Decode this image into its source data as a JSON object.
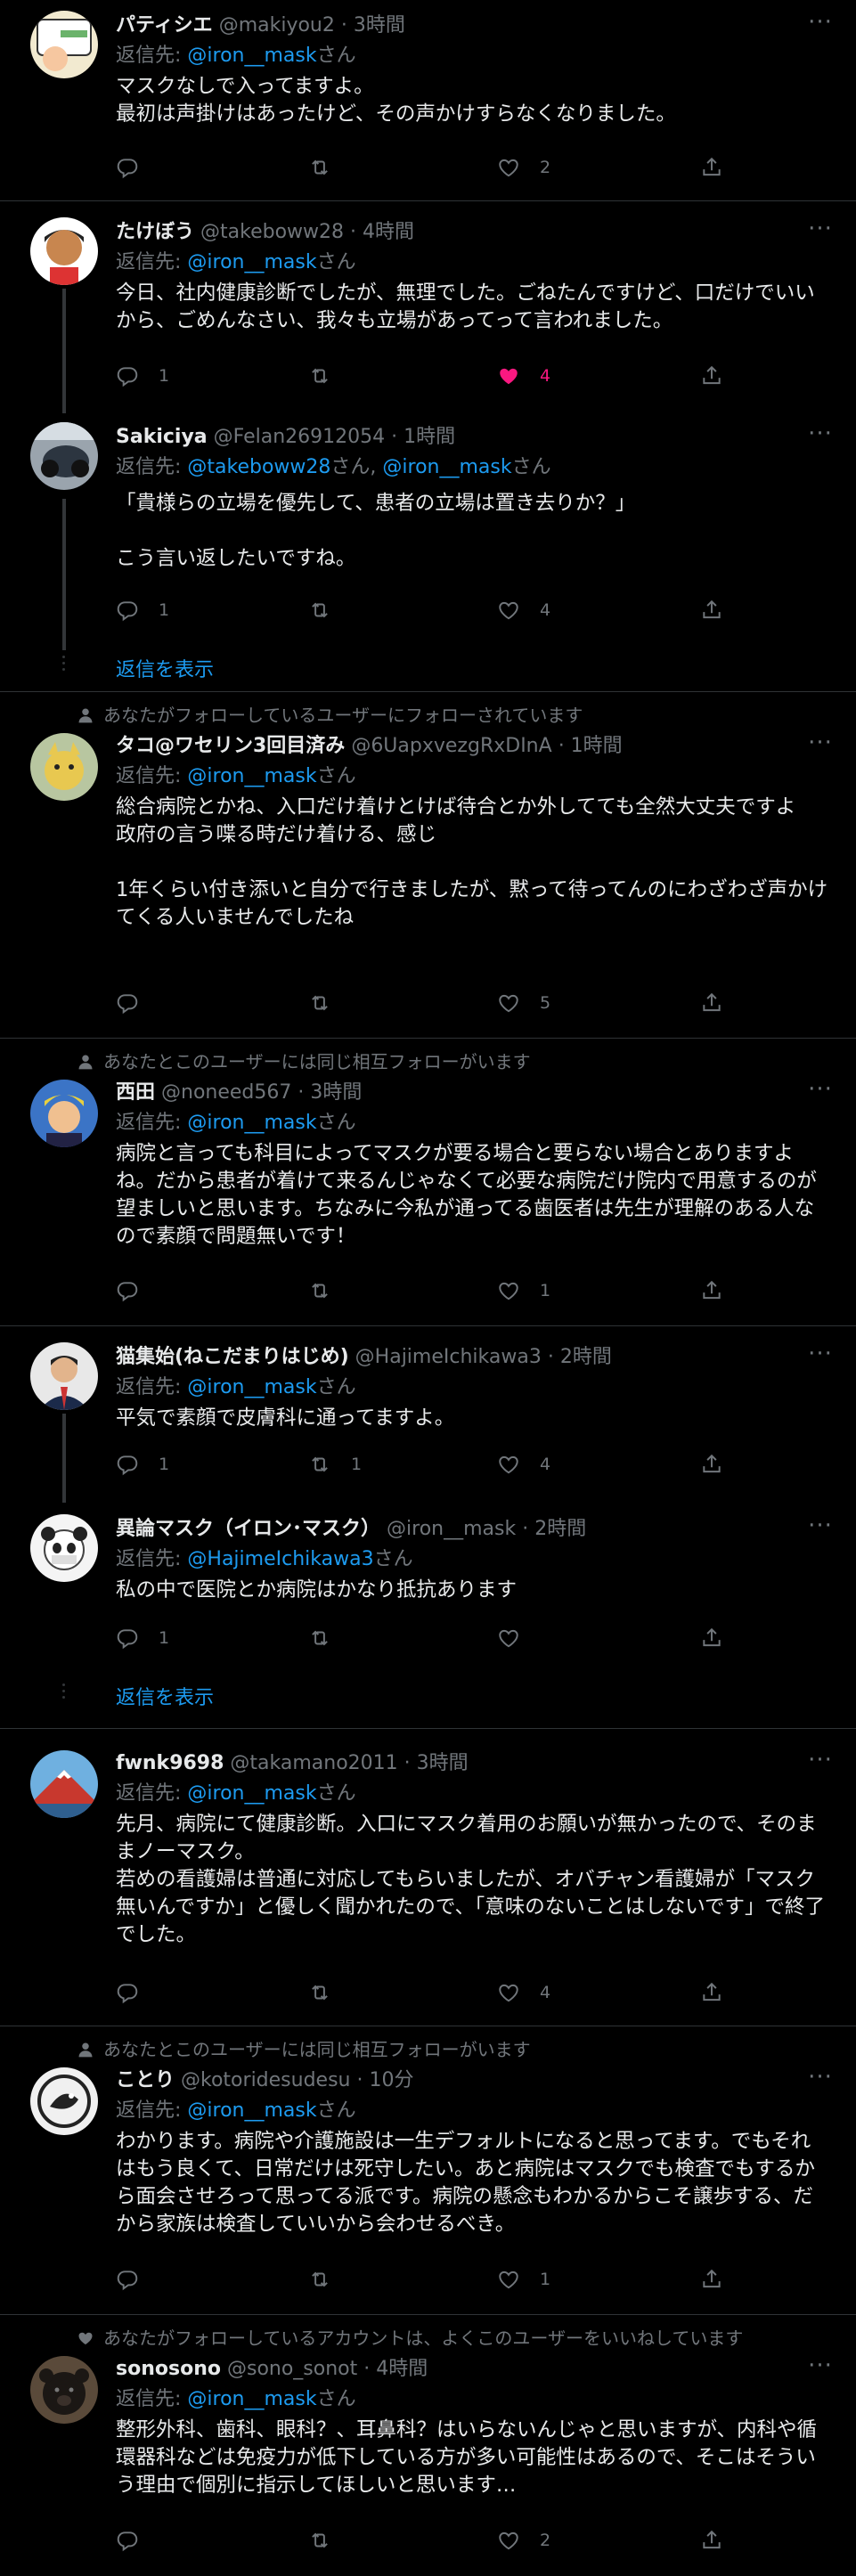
{
  "colors": {
    "background": "#000000",
    "text": "#e7e9ea",
    "muted": "#71767b",
    "link": "#1d9bf0",
    "like": "#f91880",
    "divider": "#2f3336"
  },
  "icons": {
    "reply": "reply-icon",
    "retweet": "retweet-icon",
    "like": "heart-icon",
    "share": "share-icon",
    "more": "more-icon",
    "follow": "person-icon",
    "liked_context": "heart-icon"
  },
  "show_replies": "返信を表示",
  "tweets": [
    {
      "name": "パティシエ",
      "handle": "@makiyou2",
      "time": "· 3時間",
      "reply_prefix": "返信先: ",
      "reply_to": "@iron__mask",
      "reply_suffix": "さん",
      "text": "マスクなしで入ってますよ。\n最初は声掛けはあったけど、その声かけすらなくなりました。",
      "replies": "",
      "retweets": "",
      "likes": "2"
    },
    {
      "name": "たけぼう",
      "handle": "@takeboww28",
      "time": "· 4時間",
      "reply_prefix": "返信先: ",
      "reply_to": "@iron__mask",
      "reply_suffix": "さん",
      "text": "今日、社内健康診断でしたが、無理でした。ごねたんですけど、口だけでいいから、ごめんなさい、我々も立場があってって言われました。",
      "replies": "1",
      "retweets": "",
      "likes": "4"
    },
    {
      "name": "Sakiciya",
      "handle": "@Felan26912054",
      "time": "· 1時間",
      "reply_prefix": "返信先: ",
      "reply_to": "@takeboww28",
      "reply_suffix": "さん, ",
      "reply_to2": "@iron__mask",
      "reply_suffix2": "さん",
      "text": "「貴様らの立場を優先して、患者の立場は置き去りか？」\n\nこう言い返したいですね。",
      "replies": "1",
      "retweets": "",
      "likes": "4"
    },
    {
      "social": "あなたがフォローしているユーザーにフォローされています",
      "name": "タコ@ワセリン3回目済み",
      "handle": "@6UapxvezgRxDInA",
      "time": "· 1時間",
      "reply_prefix": "返信先: ",
      "reply_to": "@iron__mask",
      "reply_suffix": "さん",
      "text": "総合病院とかね、入口だけ着けとけば待合とか外してても全然大丈夫ですよ\n政府の言う喋る時だけ着ける、感じ\n\n1年くらい付き添いと自分で行きましたが、黙って待ってんのにわざわざ声かけてくる人いませんでしたね",
      "replies": "",
      "retweets": "",
      "likes": "5"
    },
    {
      "social": "あなたとこのユーザーには同じ相互フォローがいます",
      "name": "西田",
      "handle": "@noneed567",
      "time": "· 3時間",
      "reply_prefix": "返信先: ",
      "reply_to": "@iron__mask",
      "reply_suffix": "さん",
      "text": "病院と言っても科目によってマスクが要る場合と要らない場合とありますよね。だから患者が着けて来るんじゃなくて必要な病院だけ院内で用意するのが望ましいと思います。ちなみに今私が通ってる歯医者は先生が理解のある人なので素顔で問題無いです！",
      "replies": "",
      "retweets": "",
      "likes": "1"
    },
    {
      "name": "猫集始(ねこだまりはじめ)",
      "handle": "@HajimeIchikawa3",
      "time": "· 2時間",
      "reply_prefix": "返信先: ",
      "reply_to": "@iron__mask",
      "reply_suffix": "さん",
      "text": "平気で素顔で皮膚科に通ってますよ。",
      "replies": "1",
      "retweets": "1",
      "likes": "4"
    },
    {
      "name": "異論マスク（イロン･マスク）",
      "handle": "@iron__mask",
      "time": "· 2時間",
      "reply_prefix": "返信先: ",
      "reply_to": "@HajimeIchikawa3",
      "reply_suffix": "さん",
      "text": "私の中で医院とか病院はかなり抵抗あります",
      "replies": "1",
      "retweets": "",
      "likes": ""
    },
    {
      "name": "fwnk9698",
      "handle": "@takamano2011",
      "time": "· 3時間",
      "reply_prefix": "返信先: ",
      "reply_to": "@iron__mask",
      "reply_suffix": "さん",
      "text": "先月、病院にて健康診断。入口にマスク着用のお願いが無かったので、そのままノーマスク。\n若めの看護婦は普通に対応してもらいましたが、オバチャン看護婦が「マスク無いんですか」と優しく聞かれたので、「意味のないことはしないです」で終了でした。",
      "replies": "",
      "retweets": "",
      "likes": "4"
    },
    {
      "social": "あなたとこのユーザーには同じ相互フォローがいます",
      "name": "ことり",
      "handle": "@kotoridesudesu",
      "time": "· 10分",
      "reply_prefix": "返信先: ",
      "reply_to": "@iron__mask",
      "reply_suffix": "さん",
      "text": "わかります。病院や介護施設は一生デフォルトになると思ってます。でもそれはもう良くて、日常だけは死守したい。あと病院はマスクでも検査でもするから面会させろって思ってる派です。病院の懸念もわかるからこそ譲歩する、だから家族は検査していいから会わせるべき。",
      "replies": "",
      "retweets": "",
      "likes": "1"
    },
    {
      "social": "あなたがフォローしているアカウントは、よくこのユーザーをいいねしています",
      "name": "sonosono",
      "handle": "@sono_sonot",
      "time": "· 4時間",
      "reply_prefix": "返信先: ",
      "reply_to": "@iron__mask",
      "reply_suffix": "さん",
      "text": "整形外科、歯科、眼科？、耳鼻科？はいらないんじゃと思いますが、内科や循環器科などは免疫力が低下している方が多い可能性はあるので、そこはそういう理由で個別に指示してほしいと思います…",
      "replies": "",
      "retweets": "",
      "likes": "2"
    }
  ]
}
